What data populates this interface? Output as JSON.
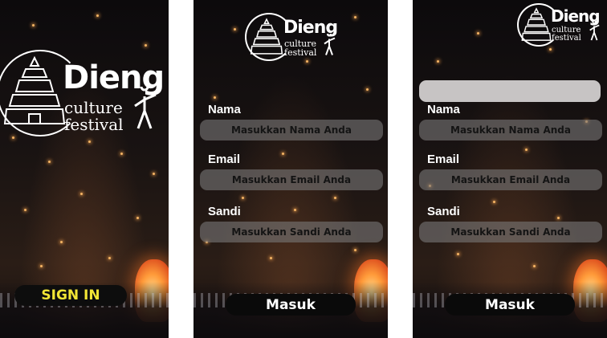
{
  "logo": {
    "title": "Dieng",
    "line1": "culture",
    "line2": "festival",
    "icon": "dieng-festival-logo"
  },
  "screen1": {
    "signin_label": "SIGN IN"
  },
  "form": {
    "nama_label": "Nama",
    "nama_placeholder": "Masukkan Nama Anda",
    "email_label": "Email",
    "email_placeholder": "Masukkan Email Anda",
    "sandi_label": "Sandi",
    "sandi_placeholder": "Masukkan Sandi Anda",
    "submit_label": "Masuk"
  },
  "colors": {
    "accent_yellow": "#f2e535",
    "button_bg": "#0d0d0d",
    "input_bg": "#787676",
    "alert_bar": "#c7c4c4"
  }
}
